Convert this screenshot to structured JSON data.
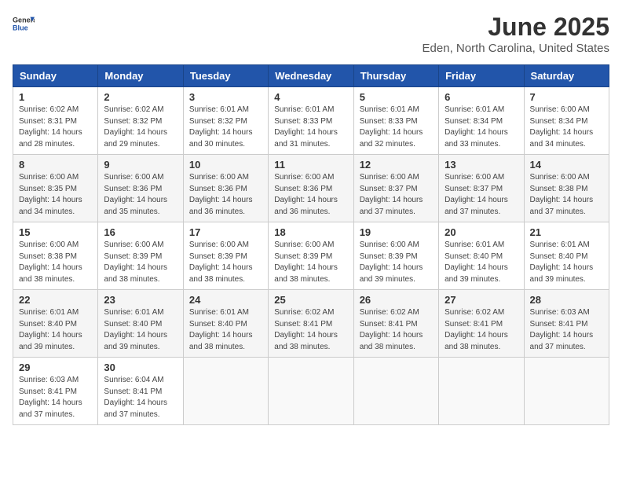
{
  "logo": {
    "general": "General",
    "blue": "Blue"
  },
  "title": "June 2025",
  "subtitle": "Eden, North Carolina, United States",
  "header_days": [
    "Sunday",
    "Monday",
    "Tuesday",
    "Wednesday",
    "Thursday",
    "Friday",
    "Saturday"
  ],
  "weeks": [
    [
      {
        "day": "1",
        "sunrise": "6:02 AM",
        "sunset": "8:31 PM",
        "daylight": "14 hours and 28 minutes."
      },
      {
        "day": "2",
        "sunrise": "6:02 AM",
        "sunset": "8:32 PM",
        "daylight": "14 hours and 29 minutes."
      },
      {
        "day": "3",
        "sunrise": "6:01 AM",
        "sunset": "8:32 PM",
        "daylight": "14 hours and 30 minutes."
      },
      {
        "day": "4",
        "sunrise": "6:01 AM",
        "sunset": "8:33 PM",
        "daylight": "14 hours and 31 minutes."
      },
      {
        "day": "5",
        "sunrise": "6:01 AM",
        "sunset": "8:33 PM",
        "daylight": "14 hours and 32 minutes."
      },
      {
        "day": "6",
        "sunrise": "6:01 AM",
        "sunset": "8:34 PM",
        "daylight": "14 hours and 33 minutes."
      },
      {
        "day": "7",
        "sunrise": "6:00 AM",
        "sunset": "8:34 PM",
        "daylight": "14 hours and 34 minutes."
      }
    ],
    [
      {
        "day": "8",
        "sunrise": "6:00 AM",
        "sunset": "8:35 PM",
        "daylight": "14 hours and 34 minutes."
      },
      {
        "day": "9",
        "sunrise": "6:00 AM",
        "sunset": "8:36 PM",
        "daylight": "14 hours and 35 minutes."
      },
      {
        "day": "10",
        "sunrise": "6:00 AM",
        "sunset": "8:36 PM",
        "daylight": "14 hours and 36 minutes."
      },
      {
        "day": "11",
        "sunrise": "6:00 AM",
        "sunset": "8:36 PM",
        "daylight": "14 hours and 36 minutes."
      },
      {
        "day": "12",
        "sunrise": "6:00 AM",
        "sunset": "8:37 PM",
        "daylight": "14 hours and 37 minutes."
      },
      {
        "day": "13",
        "sunrise": "6:00 AM",
        "sunset": "8:37 PM",
        "daylight": "14 hours and 37 minutes."
      },
      {
        "day": "14",
        "sunrise": "6:00 AM",
        "sunset": "8:38 PM",
        "daylight": "14 hours and 37 minutes."
      }
    ],
    [
      {
        "day": "15",
        "sunrise": "6:00 AM",
        "sunset": "8:38 PM",
        "daylight": "14 hours and 38 minutes."
      },
      {
        "day": "16",
        "sunrise": "6:00 AM",
        "sunset": "8:39 PM",
        "daylight": "14 hours and 38 minutes."
      },
      {
        "day": "17",
        "sunrise": "6:00 AM",
        "sunset": "8:39 PM",
        "daylight": "14 hours and 38 minutes."
      },
      {
        "day": "18",
        "sunrise": "6:00 AM",
        "sunset": "8:39 PM",
        "daylight": "14 hours and 38 minutes."
      },
      {
        "day": "19",
        "sunrise": "6:00 AM",
        "sunset": "8:39 PM",
        "daylight": "14 hours and 39 minutes."
      },
      {
        "day": "20",
        "sunrise": "6:01 AM",
        "sunset": "8:40 PM",
        "daylight": "14 hours and 39 minutes."
      },
      {
        "day": "21",
        "sunrise": "6:01 AM",
        "sunset": "8:40 PM",
        "daylight": "14 hours and 39 minutes."
      }
    ],
    [
      {
        "day": "22",
        "sunrise": "6:01 AM",
        "sunset": "8:40 PM",
        "daylight": "14 hours and 39 minutes."
      },
      {
        "day": "23",
        "sunrise": "6:01 AM",
        "sunset": "8:40 PM",
        "daylight": "14 hours and 39 minutes."
      },
      {
        "day": "24",
        "sunrise": "6:01 AM",
        "sunset": "8:40 PM",
        "daylight": "14 hours and 38 minutes."
      },
      {
        "day": "25",
        "sunrise": "6:02 AM",
        "sunset": "8:41 PM",
        "daylight": "14 hours and 38 minutes."
      },
      {
        "day": "26",
        "sunrise": "6:02 AM",
        "sunset": "8:41 PM",
        "daylight": "14 hours and 38 minutes."
      },
      {
        "day": "27",
        "sunrise": "6:02 AM",
        "sunset": "8:41 PM",
        "daylight": "14 hours and 38 minutes."
      },
      {
        "day": "28",
        "sunrise": "6:03 AM",
        "sunset": "8:41 PM",
        "daylight": "14 hours and 37 minutes."
      }
    ],
    [
      {
        "day": "29",
        "sunrise": "6:03 AM",
        "sunset": "8:41 PM",
        "daylight": "14 hours and 37 minutes."
      },
      {
        "day": "30",
        "sunrise": "6:04 AM",
        "sunset": "8:41 PM",
        "daylight": "14 hours and 37 minutes."
      },
      null,
      null,
      null,
      null,
      null
    ]
  ]
}
